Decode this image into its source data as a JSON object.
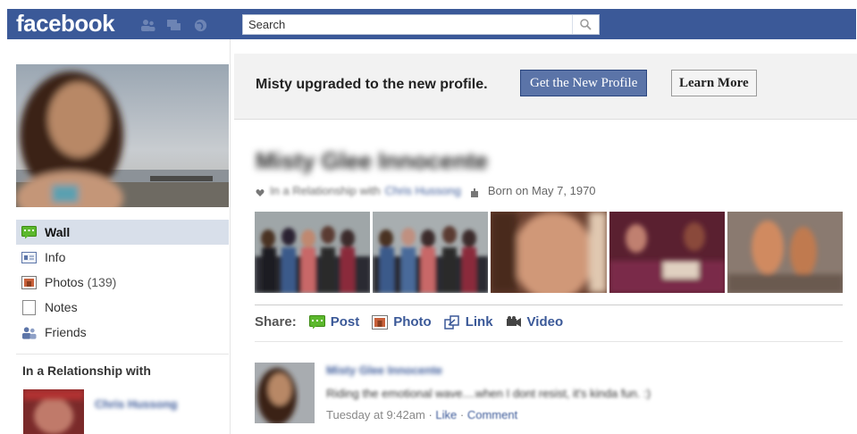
{
  "brand": {
    "logo": "facebook"
  },
  "search": {
    "placeholder": "Search"
  },
  "colors": {
    "brand_blue": "#3b5998",
    "link_blue": "#3b5998",
    "active_nav_bg": "#d8dfea",
    "button_blue": "#5b74a8"
  },
  "sidebar": {
    "items": [
      {
        "label": "Wall",
        "icon": "wall-speech-icon",
        "active": true
      },
      {
        "label": "Info",
        "icon": "info-card-icon"
      },
      {
        "label": "Photos",
        "count": "(139)",
        "icon": "photos-icon"
      },
      {
        "label": "Notes",
        "icon": "notes-icon"
      },
      {
        "label": "Friends",
        "icon": "friends-icon"
      }
    ],
    "relationship_heading": "In a Relationship with",
    "relationship_name": "Chris Hussong"
  },
  "banner": {
    "message": "Misty upgraded to the new profile.",
    "primary_button": "Get the New Profile",
    "secondary_button": "Learn More"
  },
  "profile": {
    "name": "Misty Glee Innocente",
    "relationship_prefix": "In a Relationship with",
    "relationship_partner": "Chris Hussong",
    "born": "Born on May 7, 1970"
  },
  "share": {
    "label": "Share:",
    "items": [
      {
        "label": "Post",
        "icon": "post-icon"
      },
      {
        "label": "Photo",
        "icon": "photo-icon"
      },
      {
        "label": "Link",
        "icon": "link-icon"
      },
      {
        "label": "Video",
        "icon": "video-icon"
      }
    ]
  },
  "story": {
    "author": "Misty Glee Innocente",
    "text": "Riding the emotional wave....when I dont resist, it's kinda fun. :)",
    "time": "Tuesday at 9:42am",
    "separator": "·",
    "like": "Like",
    "comment": "Comment"
  }
}
